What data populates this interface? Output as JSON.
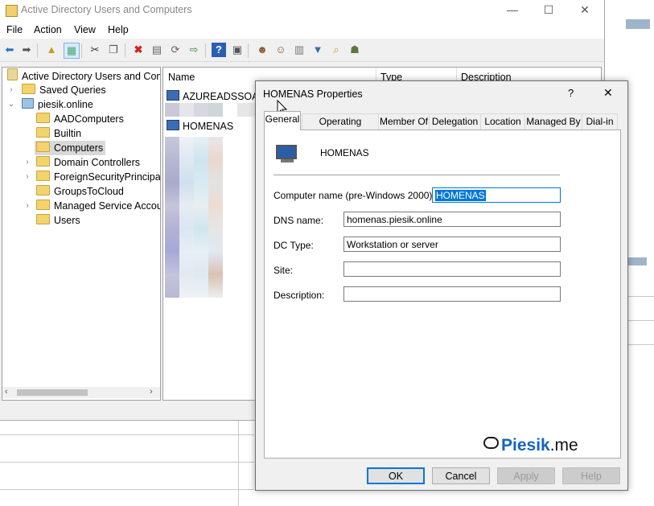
{
  "main_window": {
    "title": "Active Directory Users and Computers",
    "controls": {
      "minimize": "—",
      "maximize": "☐",
      "close": "✕"
    }
  },
  "menu": [
    "File",
    "Action",
    "View",
    "Help"
  ],
  "tree": {
    "root": "Active Directory Users and Com",
    "saved_queries": "Saved Queries",
    "domain": "piesik.online",
    "children": [
      "AADComputers",
      "Builtin",
      "Computers",
      "Domain Controllers",
      "ForeignSecurityPrincipals",
      "GroupsToCloud",
      "Managed Service Accou",
      "Users"
    ],
    "selected": "Computers"
  },
  "list": {
    "columns": {
      "name": "Name",
      "type": "Type",
      "description": "Description"
    },
    "rows": [
      "AZUREADSSOACC",
      "HOMENAS"
    ]
  },
  "dialog": {
    "title": "HOMENAS Properties",
    "help": "?",
    "close": "✕",
    "tabs": [
      "General",
      "Operating System",
      "Member Of",
      "Delegation",
      "Location",
      "Managed By",
      "Dial-in"
    ],
    "active_tab": "General",
    "computer_name_display": "HOMENAS",
    "fields": {
      "computer_name_label": "Computer name (pre-Windows 2000):",
      "computer_name_value": "HOMENAS",
      "dns_label": "DNS name:",
      "dns_value": "homenas.piesik.online",
      "dc_type_label": "DC Type:",
      "dc_type_value": "Workstation or server",
      "site_label": "Site:",
      "site_value": "",
      "description_label": "Description:",
      "description_value": ""
    },
    "buttons": {
      "ok": "OK",
      "cancel": "Cancel",
      "apply": "Apply",
      "help": "Help"
    }
  },
  "watermark": {
    "icon": "chat-bubble-icon",
    "brand": "Piesik",
    "suffix": ".me",
    "color": "#1565c0"
  },
  "colors": {
    "selection": "#0078d7",
    "accent": "#0078d7"
  }
}
